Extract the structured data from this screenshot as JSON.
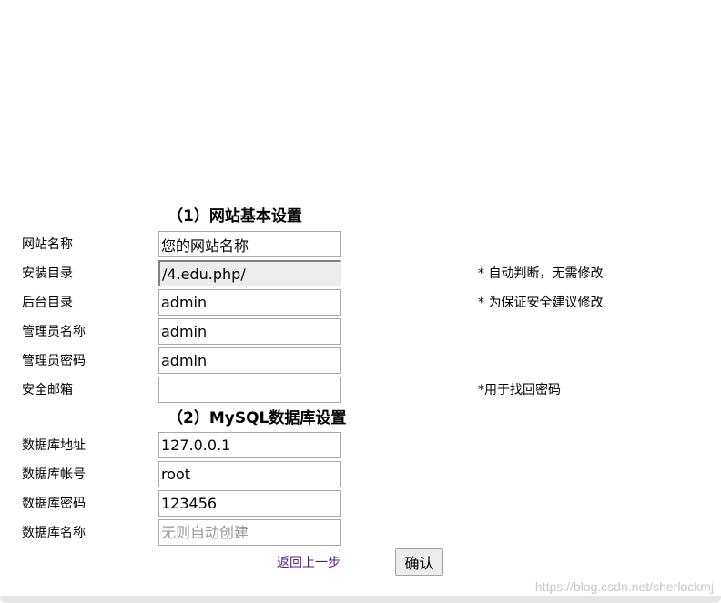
{
  "section1": {
    "title": "（1）网站基本设置",
    "rows": [
      {
        "label": "网站名称",
        "value": "您的网站名称",
        "note": ""
      },
      {
        "label": "安装目录",
        "value": "/4.edu.php/",
        "note": "* 自动判断，无需修改"
      },
      {
        "label": "后台目录",
        "value": "admin",
        "note": "* 为保证安全建议修改"
      },
      {
        "label": "管理员名称",
        "value": "admin",
        "note": ""
      },
      {
        "label": "管理员密码",
        "value": "admin",
        "note": ""
      },
      {
        "label": "安全邮箱",
        "value": "",
        "note": "*用于找回密码"
      }
    ]
  },
  "section2": {
    "title": "（2）MySQL数据库设置",
    "rows": [
      {
        "label": "数据库地址",
        "value": "127.0.0.1"
      },
      {
        "label": "数据库帐号",
        "value": "root"
      },
      {
        "label": "数据库密码",
        "value": "123456"
      },
      {
        "label": "数据库名称",
        "value": "",
        "placeholder": "无则自动创建"
      }
    ]
  },
  "actions": {
    "back_label": "返回上一步",
    "confirm_label": "确认"
  },
  "watermark": "https://blog.csdn.net/sherlockmj"
}
